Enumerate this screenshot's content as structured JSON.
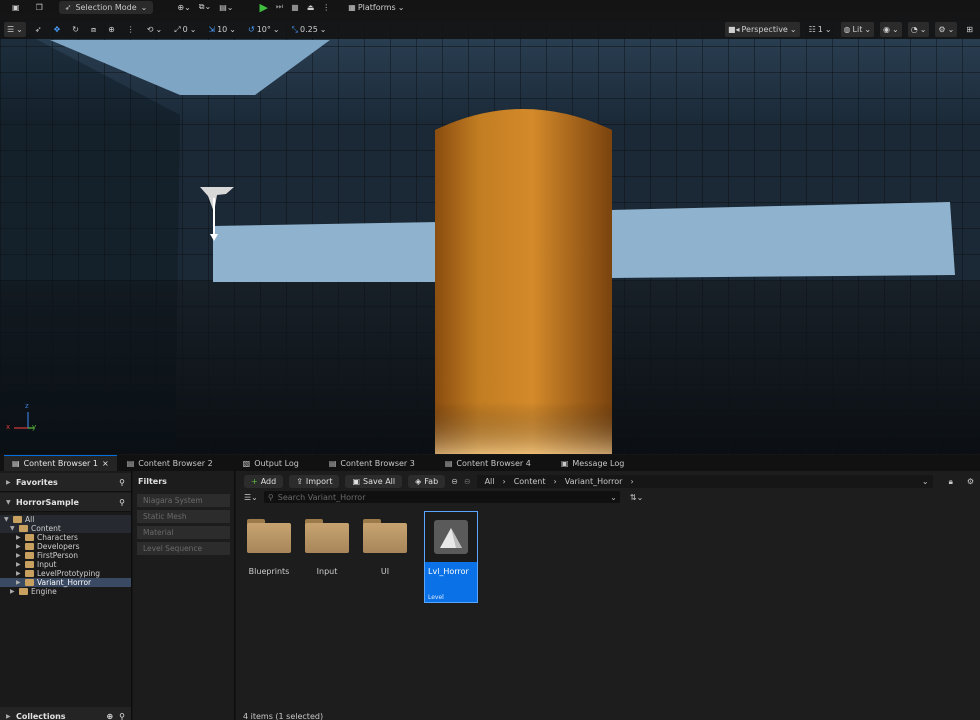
{
  "topbar": {
    "selection_mode": "Selection Mode",
    "platforms": "Platforms"
  },
  "viewport_toolbar": {
    "rotation_snap": "0",
    "grid_snap": "10",
    "angle_snap": "10°",
    "scale_snap": "0.25",
    "perspective": "Perspective",
    "layout_count": "1",
    "lit": "Lit"
  },
  "axes": {
    "x": "x",
    "y": "y",
    "z": "z"
  },
  "tabs": [
    {
      "label": "Content Browser 1",
      "active": true
    },
    {
      "label": "Content Browser 2"
    },
    {
      "label": "Output Log"
    },
    {
      "label": "Content Browser 3"
    },
    {
      "label": "Content Browser 4"
    },
    {
      "label": "Message Log"
    }
  ],
  "left": {
    "favorites": "Favorites",
    "project": "HorrorSample",
    "collections": "Collections",
    "tree": [
      "All",
      "Content",
      "Characters",
      "Developers",
      "FirstPerson",
      "Input",
      "LevelPrototyping",
      "Variant_Horror",
      "Engine"
    ]
  },
  "filters": {
    "title": "Filters",
    "items": [
      "Niagara System",
      "Static Mesh",
      "Material",
      "Level Sequence"
    ]
  },
  "main": {
    "add": "Add",
    "import": "Import",
    "save_all": "Save All",
    "fab": "Fab",
    "breadcrumb": [
      "All",
      "Content",
      "Variant_Horror"
    ],
    "search_placeholder": "Search Variant_Horror",
    "assets": [
      {
        "name": "Blueprints",
        "type": "folder"
      },
      {
        "name": "Input",
        "type": "folder"
      },
      {
        "name": "UI",
        "type": "folder"
      },
      {
        "name": "Lvl_Horror",
        "type": "Level",
        "selected": true
      }
    ],
    "status": "4 items (1 selected)"
  },
  "colors": {
    "accent": "#0070e0",
    "selected_tile": "#0a72e6",
    "pillar": "#c07a1e",
    "play": "#3fbf3f"
  }
}
